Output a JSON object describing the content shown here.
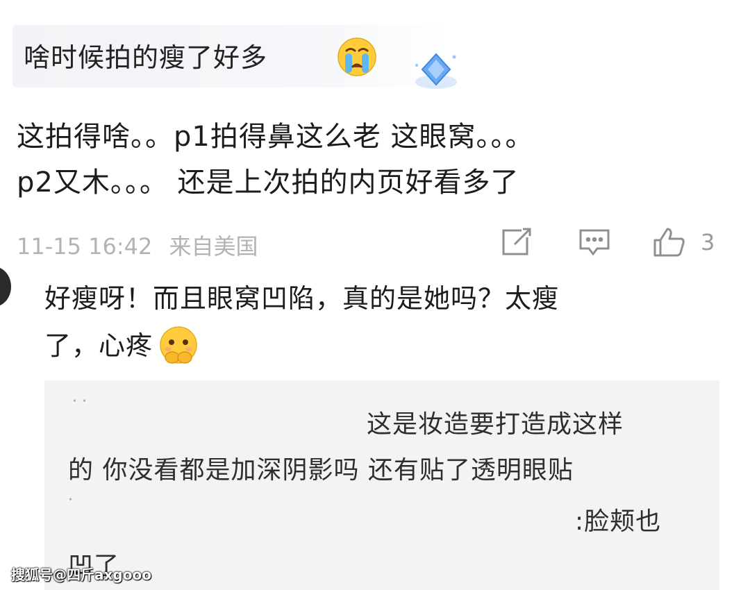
{
  "top_comment": {
    "text": "啥时候拍的瘦了好多",
    "emoji": "crying-face-emoji"
  },
  "comment": {
    "line1": "这拍得啥。。p1拍得鼻这么老 这眼窝。。。",
    "line2": "p2又木。。。 还是上次拍的内页好看多了",
    "time": "11-15 16:42",
    "location": "来自美国",
    "like_count": "3",
    "icons": [
      "share-icon",
      "comment-icon",
      "like-icon"
    ]
  },
  "reply": {
    "line1": "好瘦呀！而且眼窝凹陷，真的是她吗？太瘦",
    "line2": "了，心疼",
    "emoji": "pleading-face-emoji"
  },
  "quote": {
    "line1": "这是妆造要打造成这样",
    "line2": "的 你没看都是加深阴影吗 还有贴了透明眼贴",
    "line3": ":脸颊也",
    "line4": "凹了"
  },
  "watermark": "搜狐号@四斤axgooo",
  "colors": {
    "meta_gray": "#b3b3b3",
    "icon_gray": "#9a9a9a",
    "quote_bg": "#f3f3f3",
    "badge_blue": "#6aa8f2"
  }
}
